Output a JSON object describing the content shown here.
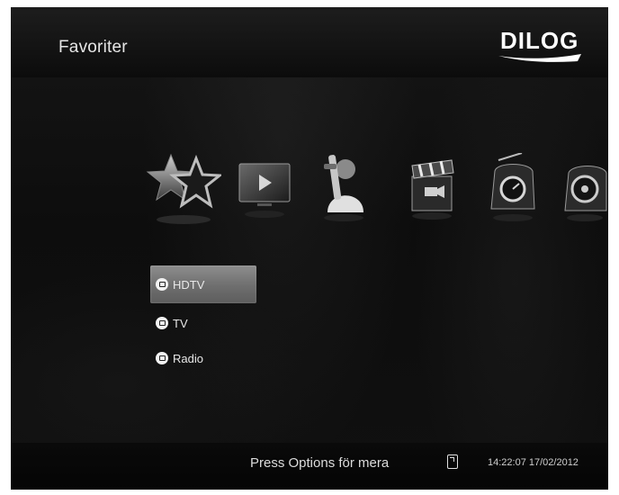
{
  "header": {
    "title": "Favoriter",
    "brand": "DILOG"
  },
  "carousel": {
    "items": [
      {
        "icon": "favorites-stars-icon",
        "selected": true
      },
      {
        "icon": "tv-play-icon"
      },
      {
        "icon": "user-settings-icon"
      },
      {
        "icon": "movie-clapper-icon"
      },
      {
        "icon": "radio-icon"
      },
      {
        "icon": "media-disc-icon"
      }
    ]
  },
  "menu": {
    "items": [
      {
        "label": "HDTV",
        "icon": "tv-channel-icon",
        "selected": true
      },
      {
        "label": "TV",
        "icon": "tv-channel-icon"
      },
      {
        "label": "Radio",
        "icon": "radio-channel-icon"
      }
    ]
  },
  "footer": {
    "hint": "Press Options för mera",
    "options_icon": "options-icon",
    "clock": "14:22:07 17/02/2012"
  }
}
